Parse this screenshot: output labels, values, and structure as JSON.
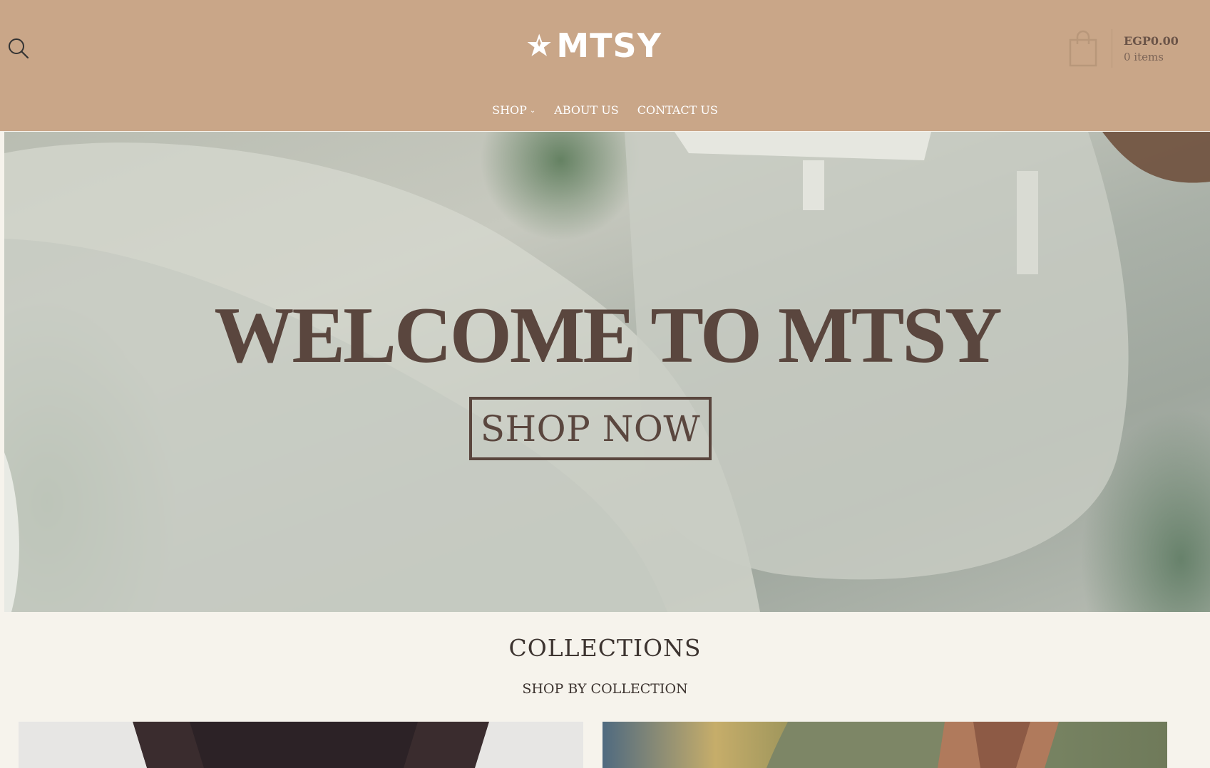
{
  "brand": {
    "name": "MTSY",
    "header_bg": "#c9a688",
    "accent_text": "#5a463e"
  },
  "header": {
    "search_icon": "search-icon",
    "nav": [
      {
        "label": "SHOP",
        "has_dropdown": true
      },
      {
        "label": "ABOUT US",
        "has_dropdown": false
      },
      {
        "label": "CONTACT US",
        "has_dropdown": false
      }
    ],
    "cart": {
      "icon": "shopping-bag-icon",
      "total": "EGP0.00",
      "items": "0 items"
    }
  },
  "hero": {
    "title": "WELCOME TO MTSY",
    "button_label": "SHOP NOW"
  },
  "collections": {
    "title": "COLLECTIONS",
    "subtitle": "SHOP BY COLLECTION"
  }
}
